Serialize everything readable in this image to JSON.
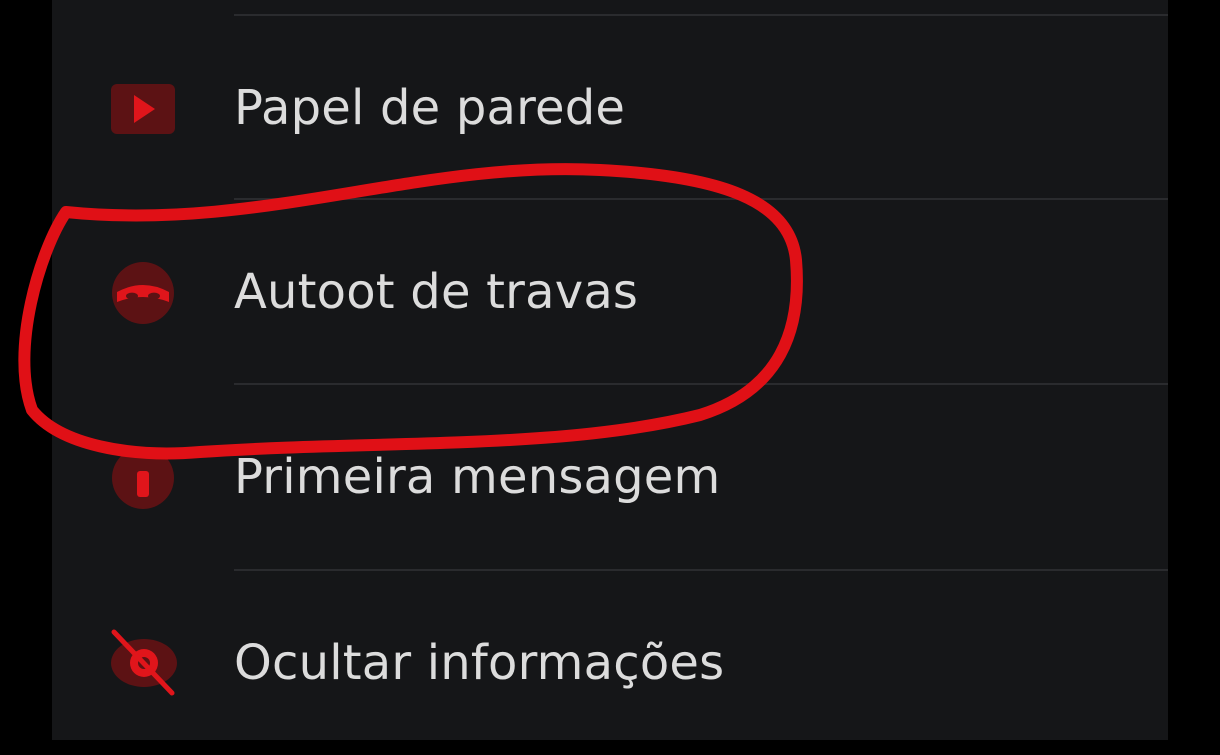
{
  "settings": {
    "items": [
      {
        "label": "Papel de parede",
        "icon": "wallpaper-play-icon"
      },
      {
        "label": "Autoot de travas",
        "icon": "ninja-mask-icon"
      },
      {
        "label": "Primeira mensagem",
        "icon": "first-message-icon"
      },
      {
        "label": "Ocultar informações",
        "icon": "hide-info-icon"
      }
    ]
  },
  "colors": {
    "background": "#151618",
    "accent": "#e0151b",
    "icon_bg": "#5c1214",
    "text": "#dcdcdc",
    "annotation": "#e01016"
  }
}
